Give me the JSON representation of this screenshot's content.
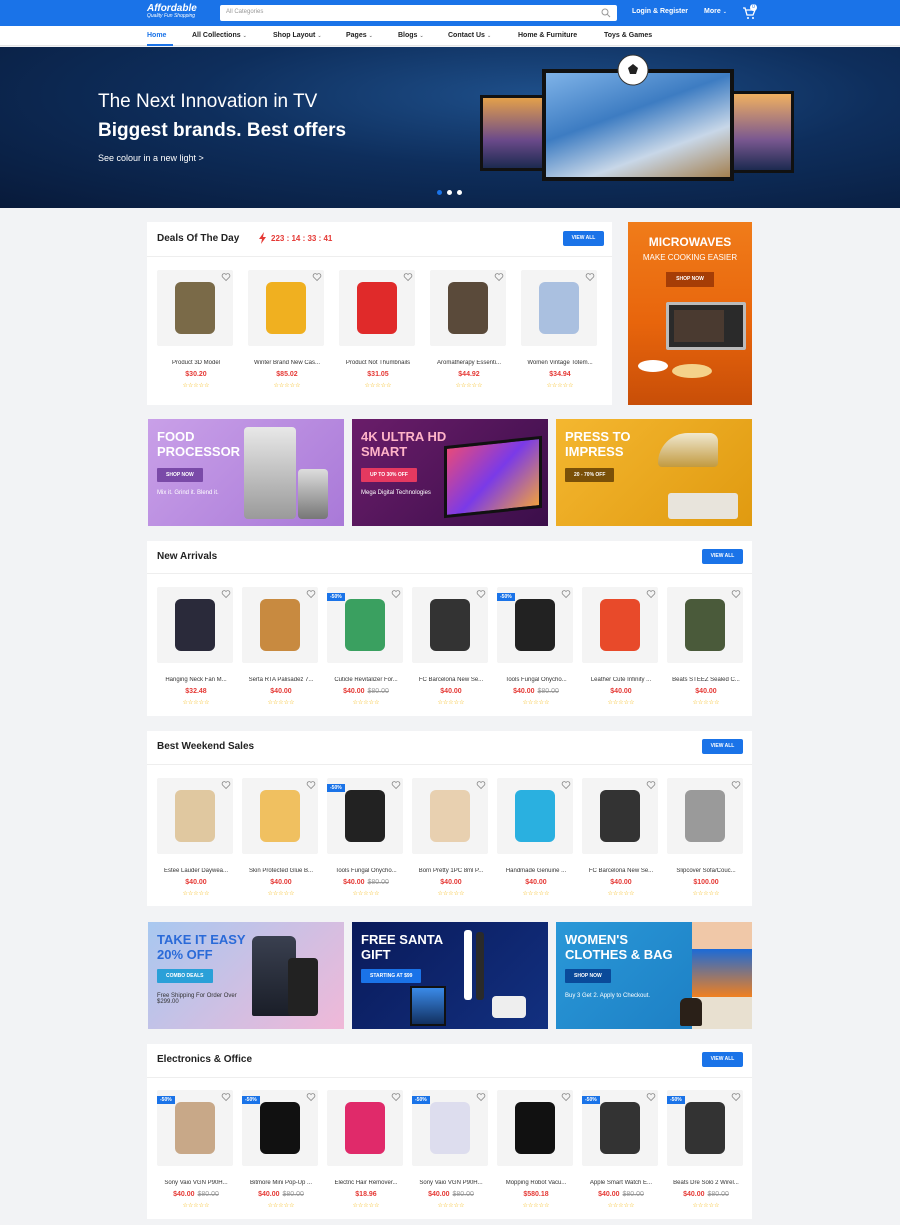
{
  "header": {
    "brand": "Affordable",
    "tagline": "Quality Fun Shopping",
    "search_placeholder": "All Categories",
    "login_label": "Login & Register",
    "more_label": "More",
    "cart_count": "0"
  },
  "nav": {
    "items": [
      "Home",
      "All Collections",
      "Shop Layout",
      "Pages",
      "Blogs",
      "Contact Us",
      "Home & Furniture",
      "Toys & Games"
    ]
  },
  "hero": {
    "line1": "The Next Innovation in TV",
    "line2": "Biggest brands. Best offers",
    "link": "See colour in a new light >"
  },
  "deals": {
    "title": "Deals Of The Day",
    "timer": "223 : 14 : 33 : 41",
    "view_all": "VIEW ALL",
    "products": [
      {
        "name": "Product 3D Model",
        "price": "$30.20",
        "old": ""
      },
      {
        "name": "Winter Brand New Cas...",
        "price": "$85.02",
        "old": ""
      },
      {
        "name": "Product Not Thumbnails",
        "price": "$31.05",
        "old": ""
      },
      {
        "name": "Aromatherapy Essenti...",
        "price": "$44.92",
        "old": ""
      },
      {
        "name": "Women Vintage Totem...",
        "price": "$34.94",
        "old": ""
      }
    ]
  },
  "side_banner": {
    "title": "MICROWAVES",
    "subtitle": "MAKE COOKING EASIER",
    "button": "SHOP NOW"
  },
  "promo_row1": [
    {
      "title": "FOOD PROCESSOR",
      "button": "SHOP NOW",
      "sub": "Mix it. Grind it. Blend it."
    },
    {
      "title": "4K ULTRA HD SMART",
      "button": "UP TO 30% OFF",
      "sub": "Mega Digital Technologies"
    },
    {
      "title": "PRESS TO IMPRESS",
      "button": "20 - 70% OFF",
      "sub": ""
    }
  ],
  "new_arrivals": {
    "title": "New Arrivals",
    "view_all": "VIEW ALL",
    "products": [
      {
        "name": "Hanging Neck Fan M...",
        "price": "$32.48",
        "old": "",
        "badge": ""
      },
      {
        "name": "Serta RTA Palisadez 7...",
        "price": "$40.00",
        "old": "",
        "badge": ""
      },
      {
        "name": "Cuticle Revitalizer For...",
        "price": "$40.00",
        "old": "$80.00",
        "badge": "-50%"
      },
      {
        "name": "FC Barcelona New Se...",
        "price": "$40.00",
        "old": "",
        "badge": ""
      },
      {
        "name": "Tools Fungal Onycho...",
        "price": "$40.00",
        "old": "$80.00",
        "badge": "-50%"
      },
      {
        "name": "Leather Cute Infinity ...",
        "price": "$40.00",
        "old": "",
        "badge": ""
      },
      {
        "name": "Beats STEEZ Sealed C...",
        "price": "$40.00",
        "old": "",
        "badge": ""
      }
    ]
  },
  "weekend_sales": {
    "title": "Best Weekend Sales",
    "view_all": "VIEW ALL",
    "products": [
      {
        "name": "Estee Lauder Daywea...",
        "price": "$40.00",
        "old": "",
        "badge": ""
      },
      {
        "name": "Skin Protected Glue B...",
        "price": "$40.00",
        "old": "",
        "badge": ""
      },
      {
        "name": "Tools Fungal Onycho...",
        "price": "$40.00",
        "old": "$80.00",
        "badge": "-50%"
      },
      {
        "name": "Born Pretty 1PC 8ml P...",
        "price": "$40.00",
        "old": "",
        "badge": ""
      },
      {
        "name": "Handmade Genuine ...",
        "price": "$40.00",
        "old": "",
        "badge": ""
      },
      {
        "name": "FC Barcelona New Se...",
        "price": "$40.00",
        "old": "",
        "badge": ""
      },
      {
        "name": "Slipcover Sofa/Couc...",
        "price": "$100.00",
        "old": "",
        "badge": ""
      }
    ]
  },
  "promo_row2": [
    {
      "title": "TAKE IT EASY 20% OFF",
      "button": "COMBO DEALS",
      "sub": "Free Shipping For Order Over $299.00"
    },
    {
      "title": "FREE SANTA GIFT",
      "button": "STARTING AT $99",
      "sub": ""
    },
    {
      "title": "WOMEN'S CLOTHES & BAG",
      "button": "SHOP NOW",
      "sub": "Buy 3 Get 2. Apply to Checkout."
    }
  ],
  "electronics": {
    "title": "Electronics & Office",
    "view_all": "VIEW ALL",
    "products": [
      {
        "name": "Sony Vaio VGN P90H...",
        "price": "$40.00",
        "old": "$80.00",
        "badge": "-50%"
      },
      {
        "name": "Bitmore Mini Pop-Up ...",
        "price": "$40.00",
        "old": "$80.00",
        "badge": "-50%"
      },
      {
        "name": "Electric Hair Remover...",
        "price": "$18.96",
        "old": "",
        "badge": ""
      },
      {
        "name": "Sony Vaio VGN P90H...",
        "price": "$40.00",
        "old": "$80.00",
        "badge": "-50%"
      },
      {
        "name": "Mopping Robot Vacu...",
        "price": "$580.18",
        "old": "",
        "badge": ""
      },
      {
        "name": "Apple Smart Watch E...",
        "price": "$40.00",
        "old": "$80.00",
        "badge": "-50%"
      },
      {
        "name": "Beats Dre Solo 2 Wirel...",
        "price": "$40.00",
        "old": "$80.00",
        "badge": "-50%"
      }
    ]
  },
  "colors": {
    "accent": "#1a73e8",
    "price": "#e53935",
    "star": "#f4b400"
  }
}
